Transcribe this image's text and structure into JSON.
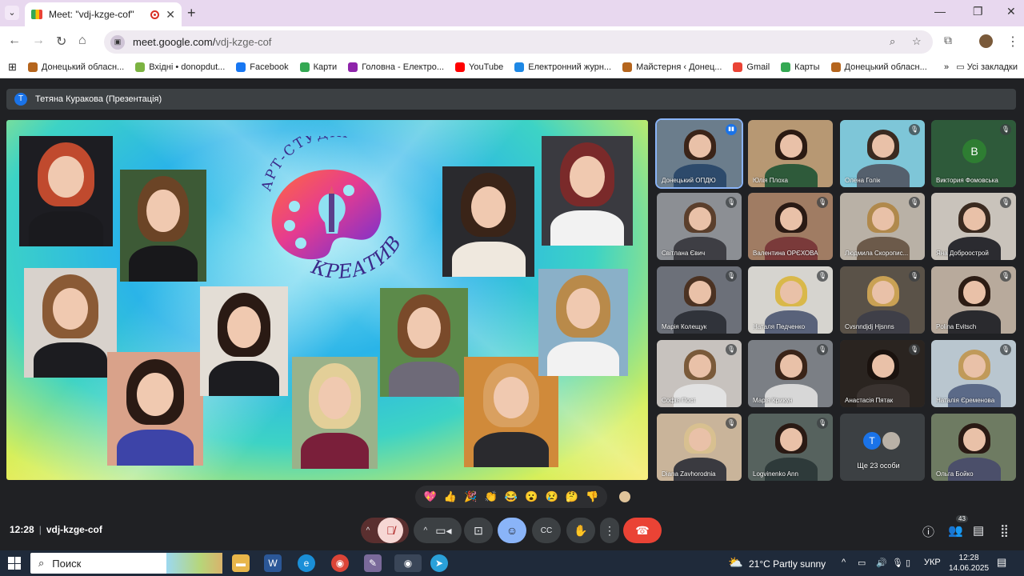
{
  "browser": {
    "tab_title": "Meet: \"vdj-kzge-cof\"",
    "url_host": "meet.google.com/",
    "url_path": "vdj-kzge-cof",
    "bookmarks": [
      {
        "label": "Донецький обласн...",
        "color": "#b5651d"
      },
      {
        "label": "Вхідні • donopdut...",
        "color": "#7cb342"
      },
      {
        "label": "Facebook",
        "color": "#1877f2"
      },
      {
        "label": "Карти",
        "color": "#34a853"
      },
      {
        "label": "Головна - Електро...",
        "color": "#8e24aa"
      },
      {
        "label": "YouTube",
        "color": "#ff0000"
      },
      {
        "label": "Електронний журн...",
        "color": "#1e88e5"
      },
      {
        "label": "Майстерня ‹ Донец...",
        "color": "#b5651d"
      },
      {
        "label": "Gmail",
        "color": "#ea4335"
      },
      {
        "label": "Карты",
        "color": "#34a853"
      },
      {
        "label": "Донецький обласн...",
        "color": "#b5651d"
      }
    ],
    "all_bookmarks": "Усі закладки"
  },
  "meet": {
    "presenter_initial": "Т",
    "presenter": "Тетяна Куракова (Презентація)",
    "slide": {
      "title_top": "АРТ-СТУДІЯ",
      "title_bottom": "КРЕАТИВ"
    },
    "participants": [
      {
        "name": "Донецький ОПДЮ",
        "bg": "#6b7d8c",
        "hair": "#3b2418",
        "body": "#2d4a6b",
        "state": "speaking"
      },
      {
        "name": "Юлія Плоха",
        "bg": "#b79873",
        "hair": "#2b1a12",
        "body": "#2e5a3a",
        "state": "none"
      },
      {
        "name": "Олена Голік",
        "bg": "#7ec6d8",
        "hair": "#3a2a20",
        "body": "#55606d",
        "state": "muted"
      },
      {
        "name": "Виктория Фомовська",
        "bg": "#2e5a3a",
        "initial": "В",
        "state": "muted"
      },
      {
        "name": "Світлана Євич",
        "bg": "#8c8f94",
        "hair": "#5b3f2c",
        "body": "#3e3e44",
        "state": "muted"
      },
      {
        "name": "Валентина ОРЄХОВА",
        "bg": "#a07c63",
        "hair": "#2a1a14",
        "body": "#7a3a3a",
        "state": "muted"
      },
      {
        "name": "Людмила Скоропис...",
        "bg": "#b9b1a6",
        "hair": "#b0894c",
        "body": "#6c5a4a",
        "state": "muted"
      },
      {
        "name": "Яна Доброострой",
        "bg": "#c9c3bb",
        "hair": "#3a2a20",
        "body": "#2b2b30",
        "state": "muted"
      },
      {
        "name": "Марія Колещук",
        "bg": "#6c7079",
        "hair": "#4b3222",
        "body": "#30333a",
        "state": "muted"
      },
      {
        "name": "Наталя Педченко",
        "bg": "#d6d4cf",
        "hair": "#d9b84a",
        "body": "#59627a",
        "state": "muted"
      },
      {
        "name": "Cvsnndjdj Hjsnns",
        "bg": "#5a5248",
        "hair": "#c9a154",
        "body": "#3f3f48",
        "state": "muted"
      },
      {
        "name": "Polina Evitsch",
        "bg": "#b8aa9c",
        "hair": "#2c1c14",
        "body": "#2a2a2e",
        "state": "muted"
      },
      {
        "name": "Софія Пост",
        "bg": "#c7c2be",
        "hair": "#7a5a3a",
        "body": "#e2e2e2",
        "state": "muted"
      },
      {
        "name": "Марія Крикун",
        "bg": "#7b7f85",
        "hair": "#3a2418",
        "body": "#d7d7d7",
        "state": "muted"
      },
      {
        "name": "Анастасія Пятак",
        "bg": "#2a2420",
        "hair": "#1a120e",
        "body": "#3a3330",
        "state": "muted"
      },
      {
        "name": "Наталія Єременова",
        "bg": "#b9c6cf",
        "hair": "#c09a5a",
        "body": "#5b6a88",
        "state": "muted"
      },
      {
        "name": "Diana Zavhorodnia",
        "bg": "#c9b49a",
        "hair": "#d8c090",
        "body": "#3a3a40",
        "state": "muted"
      },
      {
        "name": "Logvinenko Ann",
        "bg": "#56625e",
        "hair": "#2a1a14",
        "body": "#2e3a3a",
        "state": "muted"
      },
      {
        "name": "Ще 23 особи",
        "more": true,
        "state": "none"
      },
      {
        "name": "Ольга Бойко",
        "bg": "#6e7b62",
        "hair": "#2a1a14",
        "body": "#4b4f6a",
        "state": "none"
      }
    ],
    "reactions": [
      "💖",
      "👍",
      "🎉",
      "👏",
      "😂",
      "😮",
      "😢",
      "🤔",
      "👎"
    ],
    "time": "12:28",
    "code": "vdj-kzge-cof",
    "people_count": "43"
  },
  "taskbar": {
    "search": "Поиск",
    "weather": "21°C  Partly sunny",
    "lang": "УКР",
    "time": "12:28",
    "date": "14.06.2025"
  },
  "colors": {
    "end_call": "#ea4335",
    "accent": "#8ab4f8",
    "meet_bg": "#202124"
  }
}
